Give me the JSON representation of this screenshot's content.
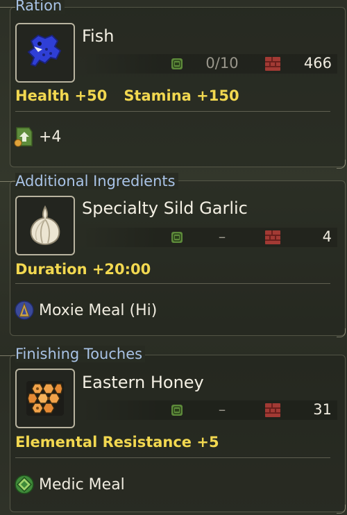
{
  "ration": {
    "section_title": "Ration",
    "item_name": "Fish",
    "item_icon": "fish-icon",
    "pouch_count": "0/10",
    "box_count": "466",
    "effects": [
      "Health +50",
      "Stamina +150"
    ],
    "bonus": "+4",
    "bonus_icon": "upgrade-scroll-icon"
  },
  "additional": {
    "section_title": "Additional Ingredients",
    "item_name": "Specialty Sild Garlic",
    "item_icon": "garlic-icon",
    "pouch_count": "–",
    "box_count": "4",
    "effect": "Duration +20:00",
    "skill": "Moxie Meal (Hi)",
    "skill_icon": "moxie-meal-icon"
  },
  "finishing": {
    "section_title": "Finishing Touches",
    "item_name": "Eastern Honey",
    "item_icon": "honey-icon",
    "pouch_count": "–",
    "box_count": "31",
    "effect": "Elemental Resistance +5",
    "skill": "Medic Meal",
    "skill_icon": "medic-meal-icon"
  },
  "colors": {
    "section_title": "#a9c3e6",
    "effect_text": "#f2d850",
    "pouch_icon": "#5d8a3a",
    "box_icon": "#a23a34"
  }
}
